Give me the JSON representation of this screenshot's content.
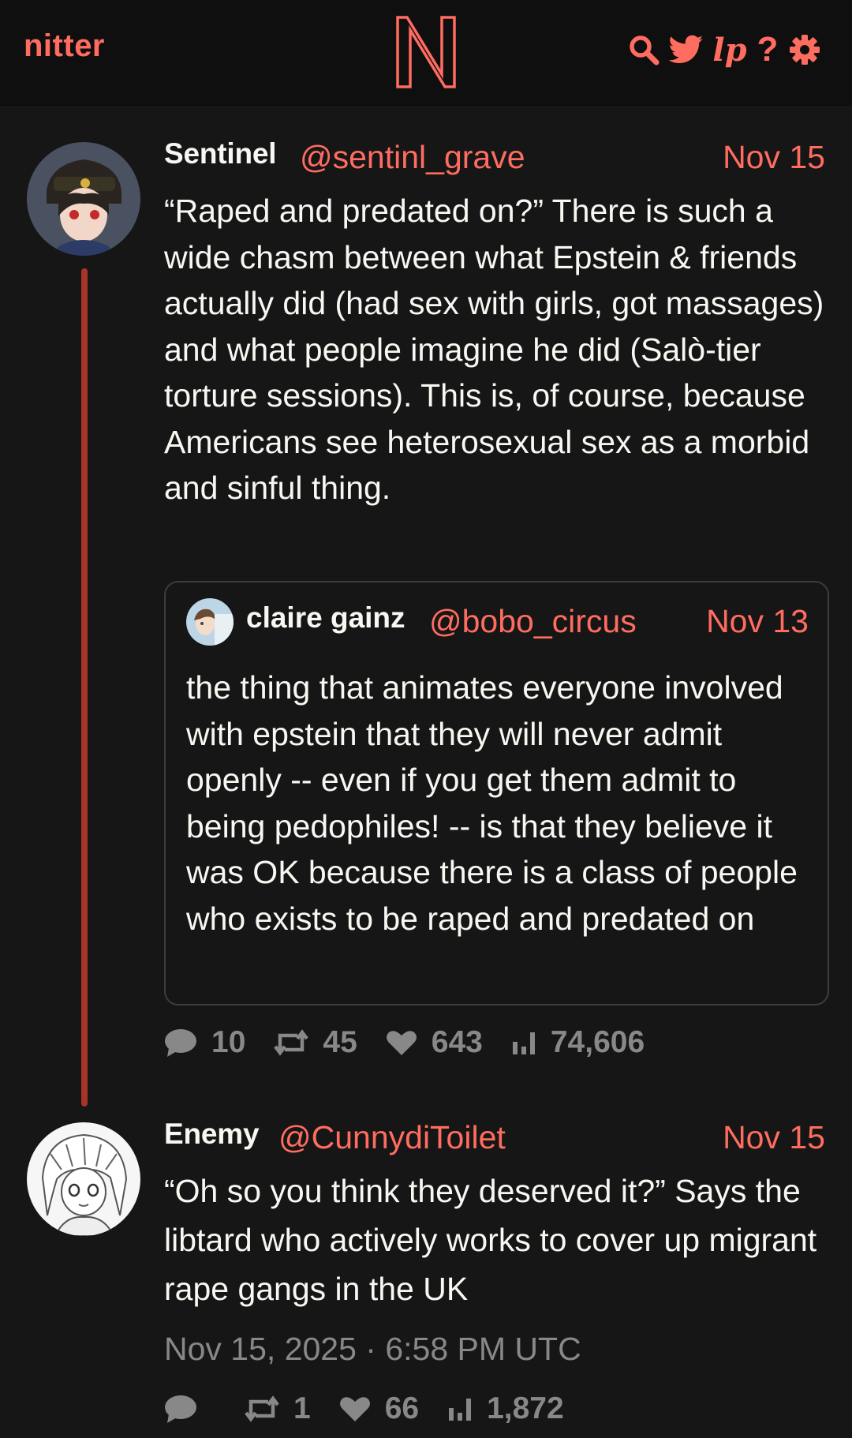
{
  "navbar": {
    "brand": "nitter",
    "logo_letter": "N",
    "lp_label": "lp",
    "help_label": "?"
  },
  "tweets": [
    {
      "fullname": "Sentinel",
      "username": "@sentinl_grave",
      "date": "Nov 15",
      "content": "“Raped and predated on?” There is such a wide chasm between what Epstein & friends actually did (had sex with girls, got massages) and what people imagine he did (Salò-tier torture sessions). This is, of course, because Americans see heterosexual sex as a morbid and sinful thing.",
      "quote": {
        "fullname": "claire gainz",
        "username": "@bobo_circus",
        "date": "Nov 13",
        "content": "the thing that animates everyone involved with epstein that they will never admit openly -- even if you get them admit to being pedophiles! -- is that they believe it was OK because there is a class of people who exists to be raped and predated on"
      },
      "stats": {
        "replies": "10",
        "retweets": "45",
        "likes": "643",
        "views": "74,606"
      }
    },
    {
      "fullname": "Enemy",
      "username": "@CunnydiToilet",
      "date": "Nov 15",
      "content": "“Oh so you think they deserved it?” Says the libtard who actively works to cover up migrant rape gangs in the UK",
      "timestamp": "Nov 15, 2025 · 6:58 PM UTC",
      "stats": {
        "replies": "",
        "retweets": "1",
        "likes": "66",
        "views": "1,872"
      }
    }
  ],
  "colors": {
    "accent": "#ff6c60",
    "background": "#161616",
    "navbar": "#0f0f0f",
    "text": "#f8f8f2",
    "muted": "#888888",
    "thread_line": "#a8332b",
    "quote_border": "#3d3d3d"
  },
  "icons": [
    "search-icon",
    "twitter-bird-icon",
    "gear-icon",
    "comment-icon",
    "retweet-icon",
    "heart-icon",
    "views-icon"
  ]
}
